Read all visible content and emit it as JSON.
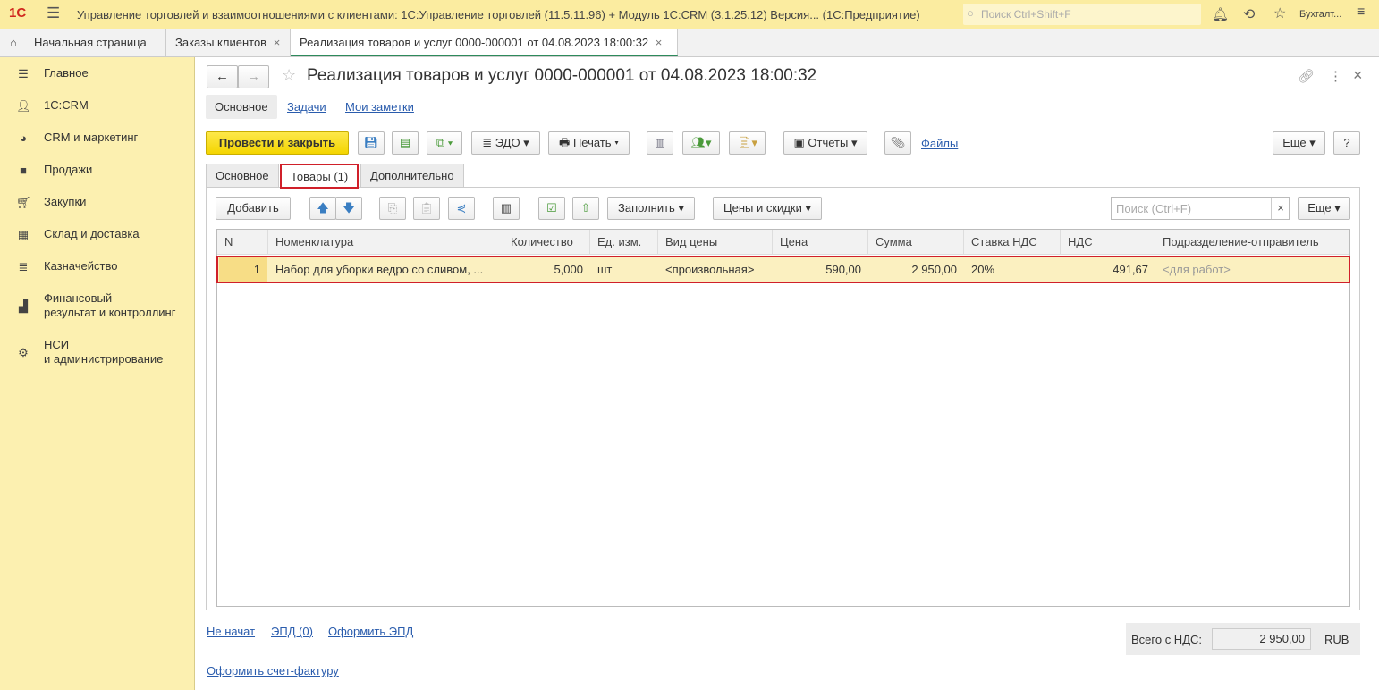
{
  "app": {
    "logo": "1С",
    "title": "Управление торговлей и взаимоотношениями с клиентами: 1С:Управление торговлей (11.5.11.96) + Модуль 1С:CRM (3.1.25.12) Версия...  (1С:Предприятие)",
    "search_placeholder": "Поиск Ctrl+Shift+F",
    "user": "Бухгалт..."
  },
  "open_tabs": [
    {
      "label": "Начальная страница"
    },
    {
      "label": "Заказы клиентов"
    },
    {
      "label": "Реализация товаров и услуг 0000-000001 от 04.08.2023 18:00:32"
    }
  ],
  "sidebar": {
    "items": [
      {
        "label": "Главное"
      },
      {
        "label": "1С:CRM"
      },
      {
        "label": "CRM и маркетинг"
      },
      {
        "label": "Продажи"
      },
      {
        "label": "Закупки"
      },
      {
        "label": "Склад и доставка"
      },
      {
        "label": "Казначейство"
      },
      {
        "label": "Финансовый",
        "label2": "результат и контроллинг"
      },
      {
        "label": "НСИ",
        "label2": "и администрирование"
      }
    ]
  },
  "document": {
    "title": "Реализация товаров и услуг 0000-000001 от 04.08.2023 18:00:32",
    "nav": [
      "Основное",
      "Задачи",
      "Мои заметки"
    ],
    "toolbar": {
      "post_close": "Провести и закрыть",
      "edo": "ЭДО",
      "print": "Печать",
      "reports": "Отчеты",
      "files": "Файлы",
      "more": "Еще",
      "help": "?"
    },
    "form_tabs": [
      "Основное",
      "Товары (1)",
      "Дополнительно"
    ],
    "table_toolbar": {
      "add": "Добавить",
      "fill": "Заполнить",
      "prices": "Цены и скидки",
      "search_placeholder": "Поиск (Ctrl+F)",
      "clear": "×",
      "more": "Еще"
    },
    "columns": [
      "N",
      "Номенклатура",
      "Количество",
      "Ед. изм.",
      "Вид цены",
      "Цена",
      "Сумма",
      "Ставка НДС",
      "НДС",
      "Подразделение-отправитель"
    ],
    "rows": [
      [
        "1",
        "Набор для уборки ведро со сливом, ...",
        "5,000",
        "шт",
        "<произвольная>",
        "590,00",
        "2 950,00",
        "20%",
        "491,67",
        "<для работ>"
      ]
    ],
    "footer": {
      "status": "Не начат",
      "epd": "ЭПД (0)",
      "make_epd": "Оформить ЭПД",
      "invoice": "Оформить счет-фактуру",
      "total_label": "Всего с НДС:",
      "total": "2 950,00",
      "currency": "RUB"
    }
  }
}
